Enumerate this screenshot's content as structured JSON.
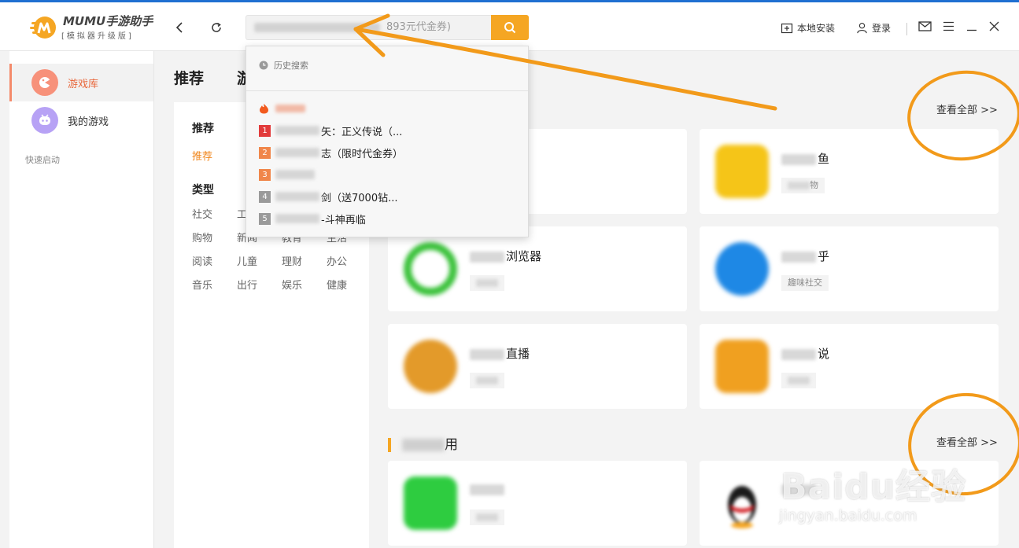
{
  "app": {
    "logo_text": "MUMU手游助手",
    "logo_sub": "[模拟器升级版]"
  },
  "toolbar": {
    "back_glyph": "‹",
    "refresh_glyph": "↻",
    "search_placeholder_visible": "893元代金券)",
    "local_install": "本地安装",
    "login": "登录"
  },
  "sidebar": {
    "items": [
      {
        "label": "游戏库",
        "active": true,
        "icon": "game-library-icon"
      },
      {
        "label": "我的游戏",
        "active": false,
        "icon": "my-games-icon"
      }
    ],
    "quick_launch": "快速启动"
  },
  "main": {
    "title": "推荐",
    "title2": "游"
  },
  "categories": {
    "head1": "推荐",
    "selected": "推荐",
    "head2": "类型",
    "items": [
      "社交",
      "工",
      "",
      "",
      "购物",
      "新闻",
      "教育",
      "生活",
      "阅读",
      "儿童",
      "理财",
      "办公",
      "音乐",
      "出行",
      "娱乐",
      "健康"
    ]
  },
  "dropdown": {
    "history_label": "历史搜索",
    "hot_label": "热门搜索",
    "hot_items": [
      {
        "rank": "1",
        "text": "矢：正义传说（...",
        "color": "#e23b3b"
      },
      {
        "rank": "2",
        "text": "志（限时代金券）",
        "color": "#f0864a"
      },
      {
        "rank": "3",
        "text": "",
        "color": "#f0864a"
      },
      {
        "rank": "4",
        "text": "剑（送7000钻...",
        "color": "#9a9a9a"
      },
      {
        "rank": "5",
        "text": "-斗神再临",
        "color": "#9a9a9a"
      }
    ]
  },
  "sections": {
    "view_all_1": "查看全部 >>",
    "view_all_2": "查看全部 >>",
    "section2_title_tail": "用"
  },
  "cards": [
    {
      "name": "",
      "tag": "",
      "icon_color": "#d8d8d8"
    },
    {
      "name": "鱼",
      "tag": "物",
      "icon_color": "#f5c518"
    },
    {
      "name": "浏览器",
      "tag": "",
      "icon_color": "#3cc23c"
    },
    {
      "name": "乎",
      "tag": "趣味社交",
      "icon_color": "#1e88e5"
    },
    {
      "name": "直播",
      "tag": "",
      "icon_color": "#e39a2a"
    },
    {
      "name": "说",
      "tag": "",
      "icon_color": "#f0a020"
    },
    {
      "name": "信",
      "tag": "",
      "icon_color": "#2ecc40"
    },
    {
      "name": "",
      "tag": "",
      "icon_color": "#222222"
    }
  ],
  "watermark": {
    "main": "Baidu经验",
    "sub": "jingyan.baidu.com"
  },
  "colors": {
    "accent": "#f5a623",
    "active_text": "#e8673b",
    "annotation": "#f29a1a"
  }
}
